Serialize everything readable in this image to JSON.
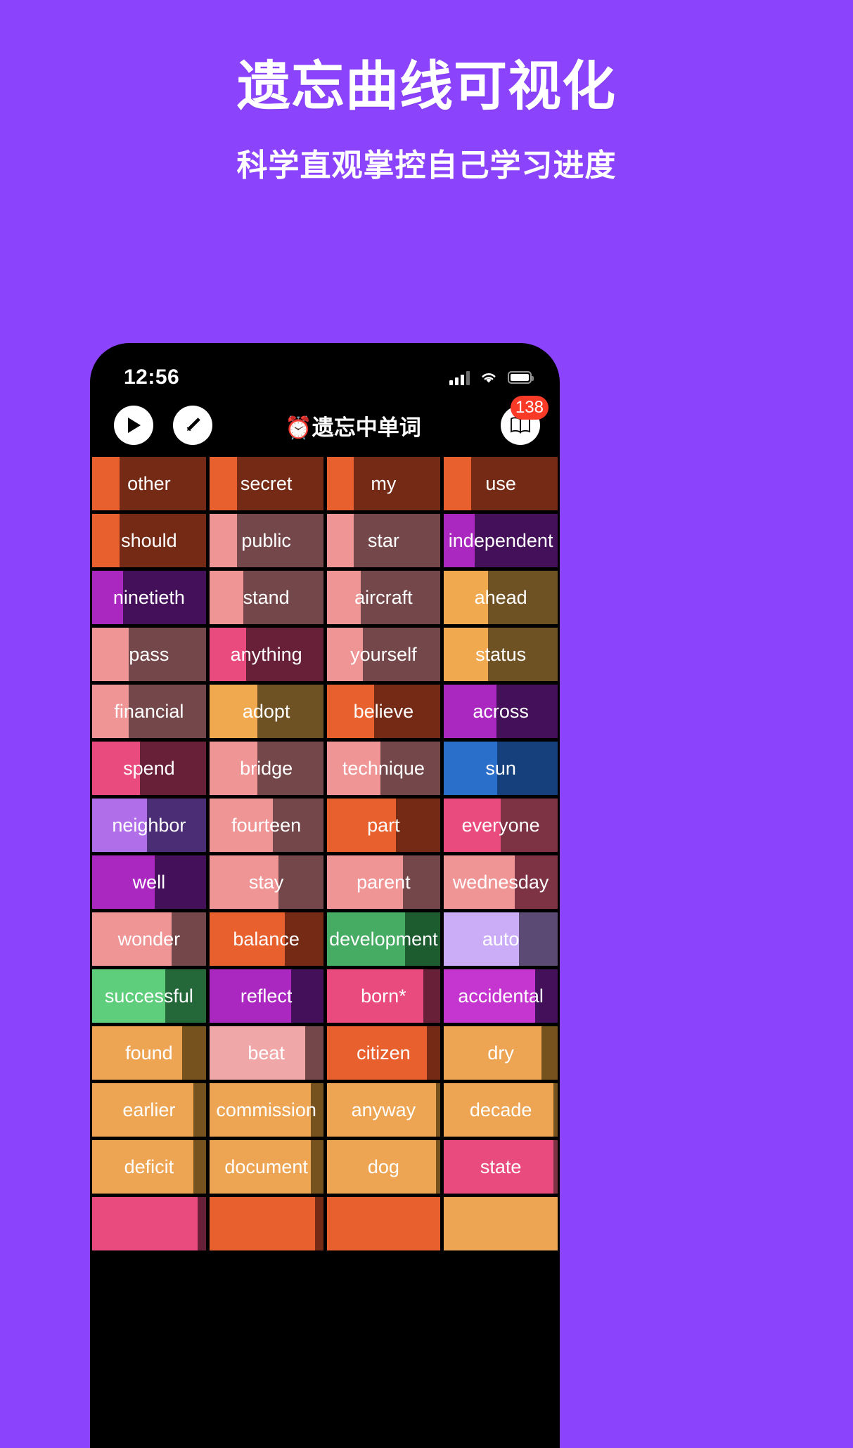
{
  "hero": {
    "title": "遗忘曲线可视化",
    "subtitle": "科学直观掌控自己学习进度"
  },
  "phone": {
    "status_bar": {
      "time": "12:56",
      "signal_icon": "cellular-signal-icon",
      "wifi_icon": "wifi-icon",
      "battery_icon": "battery-icon"
    },
    "appbar": {
      "play_label": "▶",
      "edit_label": "✎",
      "title": "⏰遗忘中单词",
      "book_label": "📖",
      "badge_count": "138"
    }
  },
  "colors": {
    "background": "#8b43fb",
    "phone_frame": "#000000",
    "badge": "#f93a26",
    "text": "#ffffff"
  },
  "grid": {
    "columns": 4,
    "cells": [
      {
        "word": "other",
        "pct": 24,
        "fg": "#e8602d",
        "bg": "#752a16"
      },
      {
        "word": "secret",
        "pct": 24,
        "fg": "#e8602d",
        "bg": "#752a16"
      },
      {
        "word": "my",
        "pct": 24,
        "fg": "#e8602d",
        "bg": "#752a16"
      },
      {
        "word": "use",
        "pct": 24,
        "fg": "#e8602d",
        "bg": "#752a16"
      },
      {
        "word": "should",
        "pct": 24,
        "fg": "#e8602d",
        "bg": "#752a16"
      },
      {
        "word": "public",
        "pct": 24,
        "fg": "#f09595",
        "bg": "#74484a"
      },
      {
        "word": "star",
        "pct": 24,
        "fg": "#f09595",
        "bg": "#74484a"
      },
      {
        "word": "independent",
        "pct": 27,
        "fg": "#ab28c0",
        "bg": "#44105a"
      },
      {
        "word": "ninetieth",
        "pct": 27,
        "fg": "#ab28c0",
        "bg": "#44105a"
      },
      {
        "word": "stand",
        "pct": 30,
        "fg": "#f09595",
        "bg": "#74484a"
      },
      {
        "word": "aircraft",
        "pct": 30,
        "fg": "#f09595",
        "bg": "#74484a"
      },
      {
        "word": "ahead",
        "pct": 39,
        "fg": "#f0a94f",
        "bg": "#6f5223"
      },
      {
        "word": "pass",
        "pct": 32,
        "fg": "#f09595",
        "bg": "#74484a"
      },
      {
        "word": "anything",
        "pct": 32,
        "fg": "#e94b7e",
        "bg": "#681f38"
      },
      {
        "word": "yourself",
        "pct": 32,
        "fg": "#f09595",
        "bg": "#74484a"
      },
      {
        "word": "status",
        "pct": 39,
        "fg": "#f0a94f",
        "bg": "#6f5223"
      },
      {
        "word": "financial",
        "pct": 32,
        "fg": "#f09595",
        "bg": "#74484a"
      },
      {
        "word": "adopt",
        "pct": 42,
        "fg": "#f0a94f",
        "bg": "#6f5223"
      },
      {
        "word": "believe",
        "pct": 42,
        "fg": "#e8602d",
        "bg": "#752a16"
      },
      {
        "word": "across",
        "pct": 46,
        "fg": "#ab28c0",
        "bg": "#44105a"
      },
      {
        "word": "spend",
        "pct": 42,
        "fg": "#e94b7e",
        "bg": "#681f38"
      },
      {
        "word": "bridge",
        "pct": 42,
        "fg": "#f09595",
        "bg": "#74484a"
      },
      {
        "word": "technique",
        "pct": 47,
        "fg": "#f09595",
        "bg": "#74484a"
      },
      {
        "word": "sun",
        "pct": 47,
        "fg": "#2a6fc9",
        "bg": "#15407c"
      },
      {
        "word": "neighbor",
        "pct": 48,
        "fg": "#b06fe8",
        "bg": "#4a2d74"
      },
      {
        "word": "fourteen",
        "pct": 56,
        "fg": "#f09595",
        "bg": "#74484a"
      },
      {
        "word": "part",
        "pct": 61,
        "fg": "#e8602d",
        "bg": "#752a16"
      },
      {
        "word": "everyone",
        "pct": 50,
        "fg": "#e94b7e",
        "bg": "#7d3344"
      },
      {
        "word": "well",
        "pct": 55,
        "fg": "#ab28c0",
        "bg": "#44105a"
      },
      {
        "word": "stay",
        "pct": 61,
        "fg": "#f09595",
        "bg": "#74484a"
      },
      {
        "word": "parent",
        "pct": 67,
        "fg": "#f09595",
        "bg": "#74484a"
      },
      {
        "word": "wednesday",
        "pct": 62,
        "fg": "#f09595",
        "bg": "#7d3344"
      },
      {
        "word": "wonder",
        "pct": 70,
        "fg": "#f09595",
        "bg": "#74484a"
      },
      {
        "word": "balance",
        "pct": 66,
        "fg": "#e8602d",
        "bg": "#752a16"
      },
      {
        "word": "development",
        "pct": 69,
        "fg": "#46ab63",
        "bg": "#1c5c2f"
      },
      {
        "word": "auto",
        "pct": 66,
        "fg": "#cbadf7",
        "bg": "#5a4a74"
      },
      {
        "word": "successful",
        "pct": 64,
        "fg": "#5ece7c",
        "bg": "#24683a"
      },
      {
        "word": "reflect",
        "pct": 72,
        "fg": "#ab28c0",
        "bg": "#44105a"
      },
      {
        "word": "born*",
        "pct": 85,
        "fg": "#e94b7e",
        "bg": "#681f38"
      },
      {
        "word": "accidental",
        "pct": 80,
        "fg": "#c436cf",
        "bg": "#44105a"
      },
      {
        "word": "found",
        "pct": 79,
        "fg": "#eda553",
        "bg": "#76521f"
      },
      {
        "word": "beat",
        "pct": 84,
        "fg": "#f0a7a7",
        "bg": "#74484a"
      },
      {
        "word": "citizen",
        "pct": 88,
        "fg": "#e8602d",
        "bg": "#752a16"
      },
      {
        "word": "dry",
        "pct": 86,
        "fg": "#eda553",
        "bg": "#76521f"
      },
      {
        "word": "earlier",
        "pct": 89,
        "fg": "#eda553",
        "bg": "#76521f"
      },
      {
        "word": "commission",
        "pct": 89,
        "fg": "#eda553",
        "bg": "#76521f"
      },
      {
        "word": "anyway",
        "pct": 96,
        "fg": "#eda553",
        "bg": "#76521f"
      },
      {
        "word": "decade",
        "pct": 96,
        "fg": "#eda553",
        "bg": "#76521f"
      },
      {
        "word": "deficit",
        "pct": 89,
        "fg": "#eda553",
        "bg": "#76521f"
      },
      {
        "word": "document",
        "pct": 89,
        "fg": "#eda553",
        "bg": "#76521f"
      },
      {
        "word": "dog",
        "pct": 96,
        "fg": "#eda553",
        "bg": "#76521f"
      },
      {
        "word": "state",
        "pct": 96,
        "fg": "#e94b7e",
        "bg": "#7d3344"
      },
      {
        "word": "",
        "pct": 93,
        "fg": "#e94b7e",
        "bg": "#681f38"
      },
      {
        "word": "",
        "pct": 93,
        "fg": "#e8602d",
        "bg": "#752a16"
      },
      {
        "word": "",
        "pct": 100,
        "fg": "#e8602d",
        "bg": "#752a16"
      },
      {
        "word": "",
        "pct": 100,
        "fg": "#eda553",
        "bg": "#76521f"
      }
    ]
  }
}
